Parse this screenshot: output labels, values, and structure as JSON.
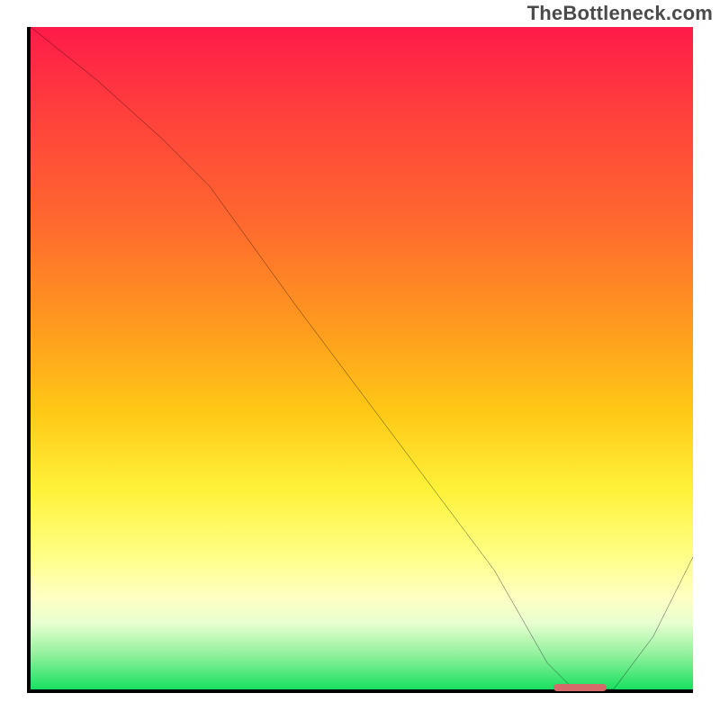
{
  "watermark": "TheBottleneck.com",
  "chart_data": {
    "type": "line",
    "title": "",
    "xlabel": "",
    "ylabel": "",
    "xlim": [
      0,
      100
    ],
    "ylim": [
      0,
      100
    ],
    "grid": false,
    "legend": false,
    "background_gradient": {
      "direction": "vertical",
      "stops": [
        {
          "pos": 0.0,
          "color": "#ff1a4a"
        },
        {
          "pos": 0.12,
          "color": "#ff3d3d"
        },
        {
          "pos": 0.3,
          "color": "#ff6a2e"
        },
        {
          "pos": 0.45,
          "color": "#ff9a1f"
        },
        {
          "pos": 0.58,
          "color": "#ffc816"
        },
        {
          "pos": 0.7,
          "color": "#fff23a"
        },
        {
          "pos": 0.8,
          "color": "#ffff88"
        },
        {
          "pos": 0.86,
          "color": "#ffffc2"
        },
        {
          "pos": 0.9,
          "color": "#e8ffd0"
        },
        {
          "pos": 0.95,
          "color": "#8cf09a"
        },
        {
          "pos": 1.0,
          "color": "#18e060"
        }
      ]
    },
    "series": [
      {
        "name": "bottleneck-curve",
        "x": [
          0,
          10,
          20,
          27,
          40,
          55,
          70,
          78,
          82,
          88,
          94,
          100
        ],
        "y": [
          100,
          92,
          83,
          76,
          58,
          38,
          18,
          4,
          0,
          0,
          8,
          20
        ]
      }
    ],
    "annotations": [
      {
        "name": "optimum-band",
        "type": "marker",
        "x_start": 79,
        "x_end": 87,
        "y": 0,
        "color": "#d46a6a"
      }
    ]
  }
}
